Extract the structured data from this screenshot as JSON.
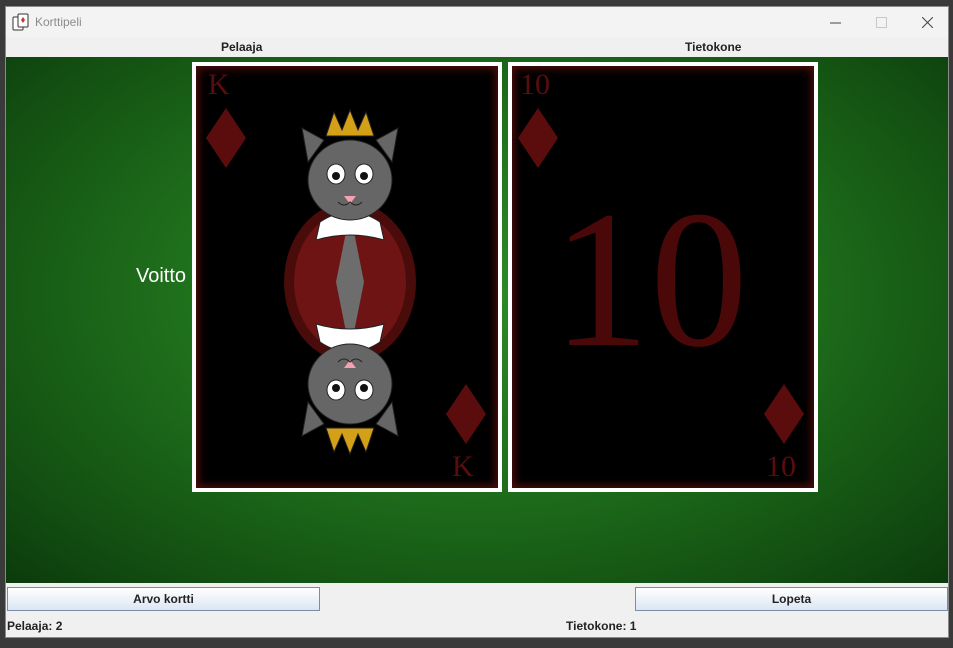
{
  "window": {
    "title": "Korttipeli",
    "app_icon": "card-game-icon"
  },
  "headers": {
    "player": "Pelaaja",
    "computer": "Tietokone"
  },
  "result_text": "Voitto",
  "player_card": {
    "rank": "K",
    "suit": "diamonds",
    "face_art": "crowned-cat-king"
  },
  "computer_card": {
    "rank": "10",
    "big_rank": "10",
    "suit": "diamonds"
  },
  "buttons": {
    "draw": "Arvo kortti",
    "quit": "Lopeta"
  },
  "scores": {
    "player": "Pelaaja: 2",
    "computer": "Tietokone: 1"
  },
  "colors": {
    "felt": "#1f701c",
    "card_back": "#000000",
    "suit": "#5b0c0c",
    "border": "#ffffff"
  }
}
